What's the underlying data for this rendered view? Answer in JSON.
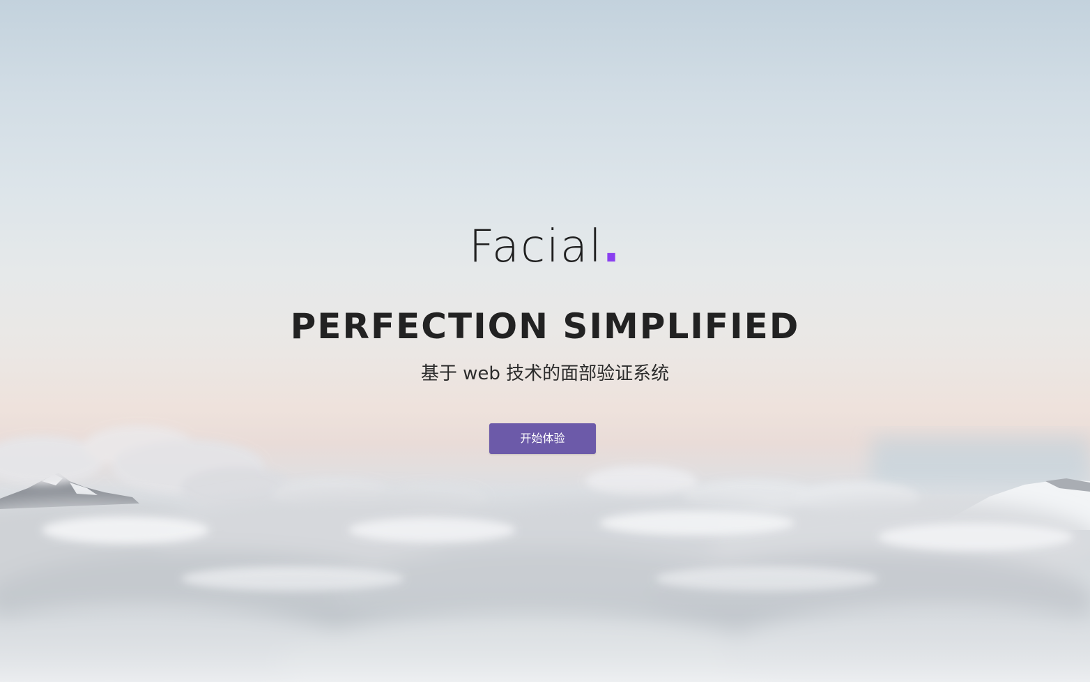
{
  "hero": {
    "brand_name": "Facial",
    "brand_dot": ".",
    "headline": "PERFECTION SIMPLIFIED",
    "subtitle": "基于 web 技术的面部验证系统",
    "cta_label": "开始体验"
  },
  "colors": {
    "accent": "#8a3ff0",
    "button": "#6c5aa9",
    "text": "#222222"
  }
}
